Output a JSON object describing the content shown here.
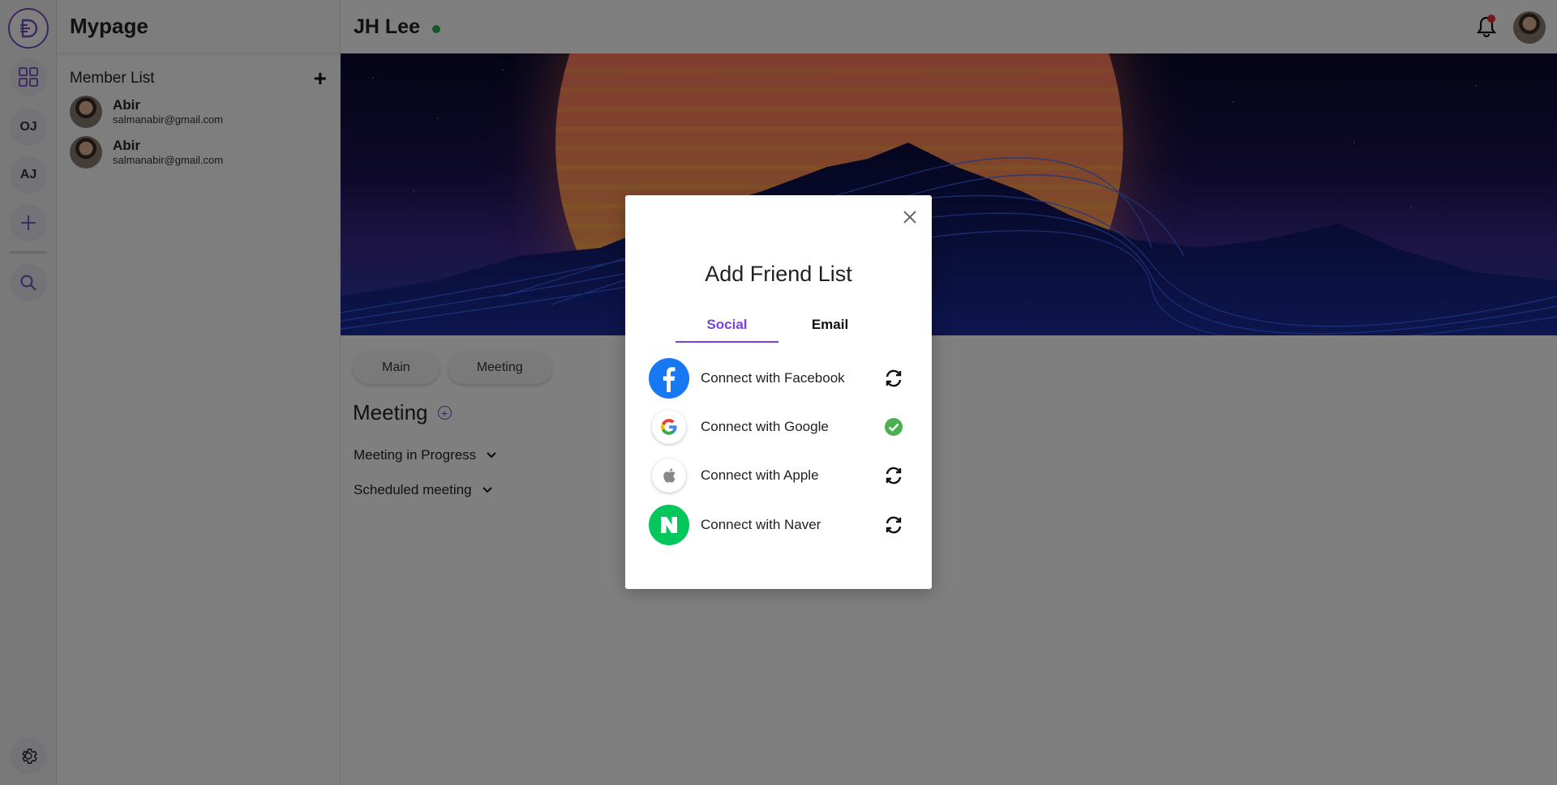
{
  "rail": {
    "logo_icon": "brand-logo-icon",
    "items": [
      {
        "icon": "grid-icon"
      },
      {
        "label": "OJ"
      },
      {
        "label": "AJ"
      },
      {
        "icon": "plus-icon"
      },
      {
        "icon": "search-icon"
      }
    ],
    "settings_icon": "gear-icon"
  },
  "panel": {
    "title": "Mypage",
    "list_title": "Member List",
    "add_symbol": "+",
    "members": [
      {
        "name": "Abir",
        "email": "salmanabir@gmail.com"
      },
      {
        "name": "Abir",
        "email": "salmanabir@gmail.com"
      }
    ]
  },
  "header": {
    "user_name": "JH Lee",
    "status_color": "#26b24b",
    "bell_icon": "bell-icon"
  },
  "main": {
    "tabs": [
      {
        "label": "Main"
      },
      {
        "label": "Meeting"
      }
    ],
    "section_title": "Meeting",
    "expanders": [
      {
        "label": "Meeting in Progress"
      },
      {
        "label": "Scheduled meeting"
      }
    ]
  },
  "modal": {
    "title": "Add Friend List",
    "tabs": [
      {
        "label": "Social",
        "active": true
      },
      {
        "label": "Email",
        "active": false
      }
    ],
    "accent_color": "#7b3fe0",
    "social": [
      {
        "label": "Connect with Facebook",
        "icon": "facebook-icon",
        "status": "refresh-icon"
      },
      {
        "label": "Connect with Google",
        "icon": "google-icon",
        "status": "check-circle-icon"
      },
      {
        "label": "Connect with Apple",
        "icon": "apple-icon",
        "status": "refresh-icon"
      },
      {
        "label": "Connect with Naver",
        "icon": "naver-icon",
        "status": "refresh-icon"
      }
    ]
  }
}
